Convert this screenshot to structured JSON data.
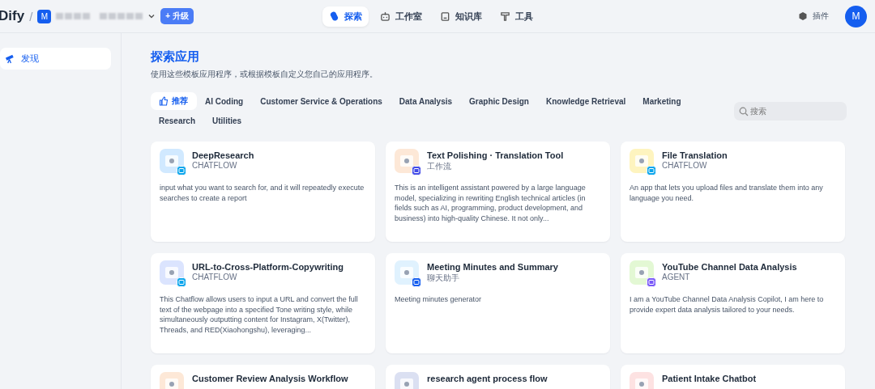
{
  "header": {
    "logo": "Dify",
    "separator": "/",
    "workspace_initial": "M",
    "upgrade": "+ 升级",
    "nav": [
      {
        "label": "探索",
        "kind": "explore",
        "selected": true
      },
      {
        "label": "工作室",
        "kind": "studio",
        "selected": false
      },
      {
        "label": "知识库",
        "kind": "knowledge",
        "selected": false
      },
      {
        "label": "工具",
        "kind": "tools",
        "selected": false
      }
    ],
    "plugins": "插件",
    "avatar": "M"
  },
  "sidebar": {
    "items": [
      {
        "label": "发现",
        "selected": true
      }
    ]
  },
  "page": {
    "title": "探索应用",
    "subtitle": "使用这些模板应用程序，或根据模板自定义您自己的应用程序。"
  },
  "categories": [
    {
      "label": "推荐",
      "selected": true
    },
    {
      "label": "AI Coding",
      "selected": false
    },
    {
      "label": "Customer Service & Operations",
      "selected": false
    },
    {
      "label": "Data Analysis",
      "selected": false
    },
    {
      "label": "Graphic Design",
      "selected": false
    },
    {
      "label": "Knowledge Retrieval",
      "selected": false
    },
    {
      "label": "Marketing",
      "selected": false
    },
    {
      "label": "Research",
      "selected": false
    },
    {
      "label": "Utilities",
      "selected": false
    }
  ],
  "search": {
    "placeholder": "搜索"
  },
  "apps": [
    {
      "name": "DeepResearch",
      "type": "CHATFLOW",
      "kind": "chatflow",
      "color": "#d1e9ff",
      "description": "input what you want to search for, and it will repeatedly execute searches to create a report"
    },
    {
      "name": "Text Polishing · Translation Tool",
      "type": "工作流",
      "kind": "workflow",
      "color": "#fde8d7",
      "description": "This is an intelligent assistant powered by a large language model, specializing in rewriting English technical articles (in fields such as AI, programming, product development, and business) into high-quality Chinese. It not only..."
    },
    {
      "name": "File Translation",
      "type": "CHATFLOW",
      "kind": "chatflow",
      "color": "#fef4bf",
      "description": "An app that lets you upload files and translate them into any language you need."
    },
    {
      "name": "URL-to-Cross-Platform-Copywriting",
      "type": "CHATFLOW",
      "kind": "chatflow",
      "color": "#dbe4fe",
      "description": "This Chatflow allows users to input a URL and convert the full text of the webpage into a specified Tone writing style, while simultaneously outputting content for Instagram, X(Twitter), Threads, and RED(Xiaohongshu), leveraging..."
    },
    {
      "name": "Meeting Minutes and Summary",
      "type": "聊天助手",
      "kind": "chat",
      "color": "#e0f2fe",
      "description": "Meeting minutes generator"
    },
    {
      "name": "YouTube Channel Data Analysis",
      "type": "AGENT",
      "kind": "agent",
      "color": "#e3f8d4",
      "description": "I am a YouTube Channel Data Analysis Copilot, I am here to provide expert data analysis tailored to your needs."
    },
    {
      "name": "Customer Review Analysis Workflow",
      "color": "#fde8d7"
    },
    {
      "name": "research agent process flow",
      "color": "#dbe0f2"
    },
    {
      "name": "Patient Intake Chatbot",
      "color": "#fde2e2"
    }
  ]
}
